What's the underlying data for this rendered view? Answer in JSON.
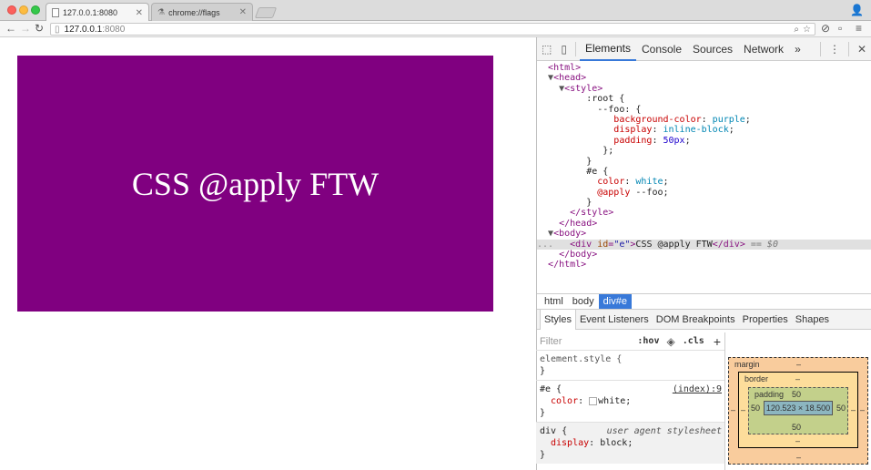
{
  "tabs": [
    {
      "title": "127.0.0.1:8080",
      "active": true
    },
    {
      "title": "chrome://flags",
      "active": false
    }
  ],
  "address": {
    "host": "127.0.0.1",
    "port": ":8080"
  },
  "page": {
    "demo_text": "CSS @apply FTW"
  },
  "devtools": {
    "tabs": [
      "Elements",
      "Console",
      "Sources",
      "Network",
      "»"
    ],
    "active_tab": "Elements",
    "tree": {
      "l1": "<html>",
      "l2": "<head>",
      "l3": "<style>",
      "l4": ":root {",
      "l5": "--foo: {",
      "l6_prop": "background-color",
      "l6_val": "purple",
      "l7_prop": "display",
      "l7_val": "inline-block",
      "l8_prop": "padding",
      "l8_val": "50px",
      "l9": "};",
      "l10": "}",
      "l11": "#e {",
      "l12_prop": "color",
      "l12_val": "white",
      "l13_prop": "@apply",
      "l13_val": "--foo",
      "l14": "}",
      "l15": "</style>",
      "l16": "</head>",
      "l17": "<body>",
      "l18_tag_open": "<div",
      "l18_attr": "id",
      "l18_attval": "\"e\"",
      "l18_text": "CSS @apply FTW",
      "l18_tag_close": "</div>",
      "l18_marker": "== $0",
      "l19": "</body>",
      "l20": "</html>"
    },
    "breadcrumbs": [
      "html",
      "body",
      "div#e"
    ],
    "subtabs": [
      "Styles",
      "Event Listeners",
      "DOM Breakpoints",
      "Properties",
      "Shapes"
    ],
    "styles": {
      "filter_placeholder": "Filter",
      "hov": ":hov",
      "cls": ".cls",
      "element_style": "element.style {",
      "close_brace": "}",
      "rule1_selector": "#e {",
      "rule1_source": "(index):9",
      "rule1_prop": "color",
      "rule1_val": "white",
      "rule2_selector": "div {",
      "rule2_source": "user agent stylesheet",
      "rule2_prop": "display",
      "rule2_val": "block"
    },
    "boxmodel": {
      "margin_label": "margin",
      "margin_top": "–",
      "margin_bottom": "–",
      "margin_left": "–",
      "margin_right": "–",
      "border_label": "border",
      "border_top": "–",
      "border_bottom": "–",
      "border_left": "–",
      "border_right": "–",
      "padding_label": "padding",
      "padding_top": "50",
      "padding_bottom": "50",
      "padding_left": "50",
      "padding_right": "50",
      "content": "120.523 × 18.500"
    }
  }
}
